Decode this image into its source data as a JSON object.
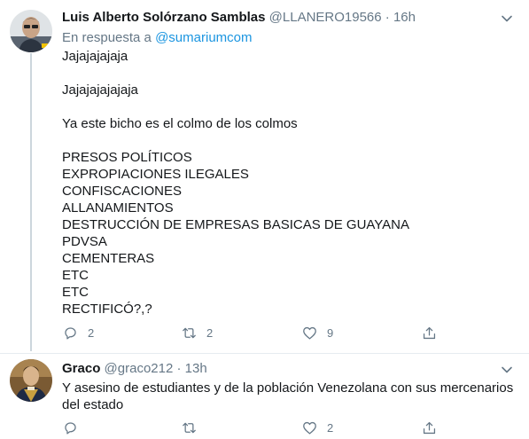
{
  "tweets": [
    {
      "author_name": "Luis Alberto Solórzano Samblas",
      "handle": "@LLANERO19566",
      "separator": "·",
      "time": "16h",
      "reply_prefix": "En respuesta a",
      "reply_handle": "@sumariumcom",
      "lines": [
        "Jajajajajaja",
        "",
        "Jajajajajajaja",
        "",
        "Ya este bicho es el colmo de los colmos",
        "",
        "PRESOS POLÍTICOS",
        "EXPROPIACIONES ILEGALES",
        "CONFISCACIONES",
        "ALLANAMIENTOS",
        "DESTRUCCIÓN DE EMPRESAS BASICAS DE GUAYANA",
        "PDVSA",
        "CEMENTERAS",
        "ETC",
        "ETC",
        "RECTIFICÓ?,?"
      ],
      "reply_count": "2",
      "retweet_count": "2",
      "like_count": "9"
    },
    {
      "author_name": "Graco",
      "handle": "@graco212",
      "separator": "·",
      "time": "13h",
      "lines": [
        "Y asesino de estudiantes y de la población Venezolana con sus mercenarios",
        "del estado"
      ],
      "reply_count": "",
      "retweet_count": "",
      "like_count": "2"
    }
  ],
  "icons": {
    "reply": "reply-icon",
    "retweet": "retweet-icon",
    "like": "heart-icon",
    "share": "share-icon",
    "more": "chevron-down-icon"
  },
  "colors": {
    "link": "#1b95e0",
    "secondary_text": "#657786",
    "thread_line": "#ccd6dd"
  }
}
